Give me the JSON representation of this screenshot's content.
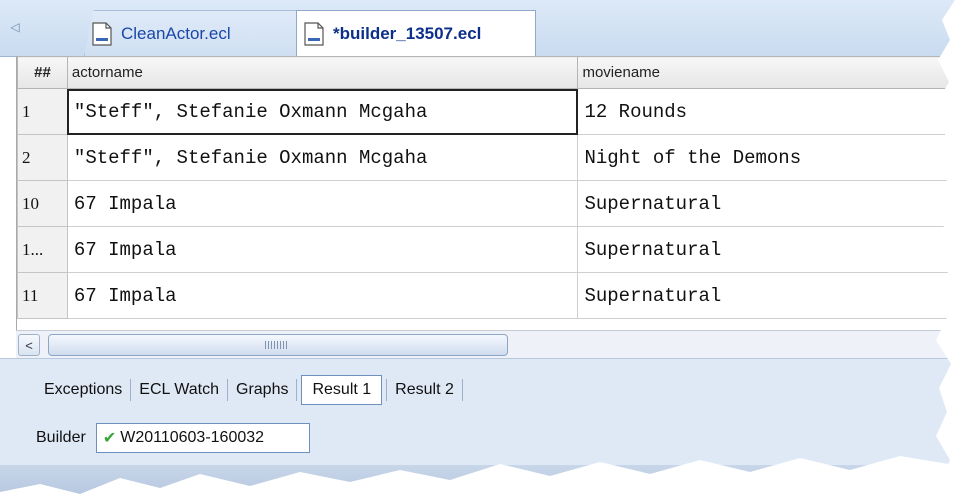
{
  "tabs": [
    {
      "label": "CleanActor.ecl"
    },
    {
      "label": "*builder_13507.ecl"
    }
  ],
  "grid": {
    "headers": [
      "##",
      "actorname",
      "moviename"
    ],
    "rows": [
      {
        "num": "1",
        "actor": "\"Steff\", Stefanie Oxmann Mcgaha",
        "movie": "12 Rounds"
      },
      {
        "num": "2",
        "actor": "\"Steff\", Stefanie Oxmann Mcgaha",
        "movie": "Night of the Demons"
      },
      {
        "num": "10",
        "actor": "67 Impala",
        "movie": "Supernatural"
      },
      {
        "num": "1...",
        "actor": "67 Impala",
        "movie": "Supernatural"
      },
      {
        "num": "11",
        "actor": "67 Impala",
        "movie": "Supernatural"
      }
    ]
  },
  "result_tabs": [
    "Exceptions",
    "ECL Watch",
    "Graphs",
    "Result 1",
    "Result 2"
  ],
  "builder": {
    "label": "Builder",
    "workunit": "W20110603-160032"
  },
  "colors": {
    "tab_active_text": "#0c2f8a",
    "tab_inactive_text": "#1a47a8",
    "panel_bg": "#dfe9f6",
    "check": "#3aa63a"
  }
}
